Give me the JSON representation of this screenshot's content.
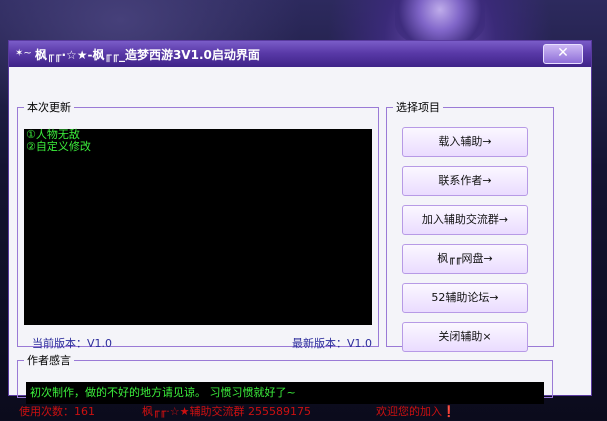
{
  "window": {
    "title": "枫╓╓·☆★-枫╓╓_造梦西游3V1.0启动界面",
    "title_icon": "✶~",
    "close_label": "✕"
  },
  "update_group": {
    "legend": "本次更新",
    "log_lines": [
      "①人物无敌",
      "②自定义修改"
    ],
    "current_version": "当前版本：V1.0",
    "latest_version": "最新版本：V1.0"
  },
  "select_group": {
    "legend": "选择项目",
    "buttons": [
      {
        "label": "载入辅助→"
      },
      {
        "label": "联系作者→"
      },
      {
        "label": "加入辅助交流群→"
      },
      {
        "label": "枫╓╓网盘→"
      },
      {
        "label": "52辅助论坛→"
      },
      {
        "label": "关闭辅助×"
      }
    ]
  },
  "thanks_group": {
    "legend": "作者感言",
    "message": "初次制作，做的不好的地方请见谅。 习惯习惯就好了~"
  },
  "status": {
    "usage": "使用次数：161",
    "group": "枫╓╓·☆★辅助交流群 255589175",
    "welcome": "欢迎您的加入❗"
  },
  "colors": {
    "accent": "#5a3aa8",
    "log_text": "#3cf03c",
    "status_text": "#cc1010"
  }
}
